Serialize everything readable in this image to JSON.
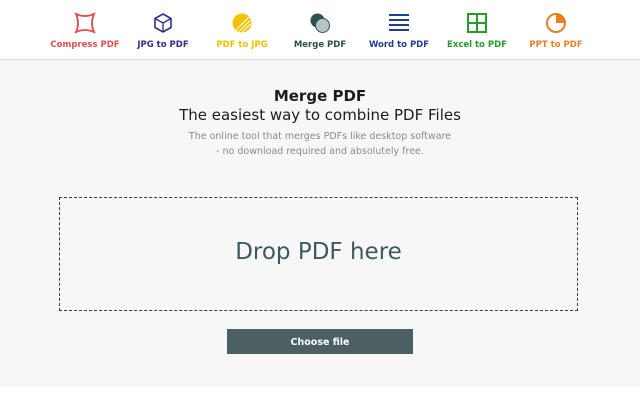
{
  "tools": [
    {
      "label": "Compress PDF",
      "icon": "compress-icon",
      "color": "#e54d4d"
    },
    {
      "label": "JPG to PDF",
      "icon": "cube-icon",
      "color": "#2d2d8c"
    },
    {
      "label": "PDF to JPG",
      "icon": "sun-icon",
      "color": "#f2c200"
    },
    {
      "label": "Merge PDF",
      "icon": "merge-circles-icon",
      "color": "#2f4f4f"
    },
    {
      "label": "Word to PDF",
      "icon": "lines-icon",
      "color": "#1f3f8f"
    },
    {
      "label": "Excel to PDF",
      "icon": "grid-icon",
      "color": "#2a9a2a"
    },
    {
      "label": "PPT to PDF",
      "icon": "pie-icon",
      "color": "#e67e22"
    }
  ],
  "hero": {
    "title": "Merge PDF",
    "subtitle": "The easiest way to combine PDF Files",
    "description_line1": "The online tool that merges PDFs like desktop software",
    "description_line2": "- no download required and absolutely free."
  },
  "dropzone": {
    "text": "Drop PDF here"
  },
  "choose_button": {
    "label": "Choose file"
  }
}
